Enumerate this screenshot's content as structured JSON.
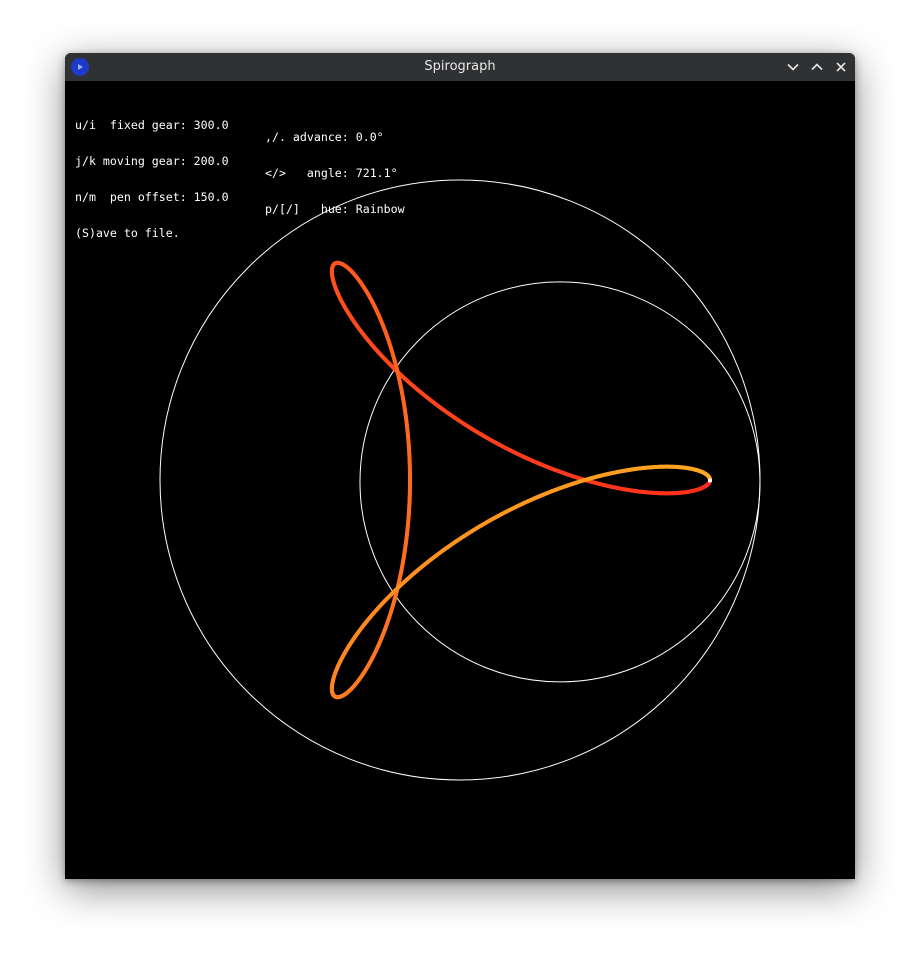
{
  "window": {
    "title": "Spirograph",
    "icon": "app-play-icon",
    "controls": [
      "minimize-icon",
      "maximize-icon",
      "close-icon"
    ]
  },
  "hud": {
    "rows": [
      {
        "left": "u/i  fixed gear: 300.0",
        "right": ",/. advance: 0.0°"
      },
      {
        "left": "j/k moving gear: 200.0",
        "right": "</>   angle: 721.1°"
      },
      {
        "left": "n/m  pen offset: 150.0",
        "right": "p/[/]   hue: Rainbow"
      },
      {
        "left": "(S)ave to file.",
        "right": ""
      }
    ]
  },
  "spirograph": {
    "fixed_gear": 300.0,
    "moving_gear": 200.0,
    "pen_offset": 150.0,
    "advance_deg": 0.0,
    "angle_deg": 721.1,
    "hue": "Rainbow",
    "colors": {
      "background": "#000000",
      "gear_outline": "#ffffff",
      "curve_start": "#ff2a1a",
      "curve_end": "#ffaa22"
    }
  }
}
